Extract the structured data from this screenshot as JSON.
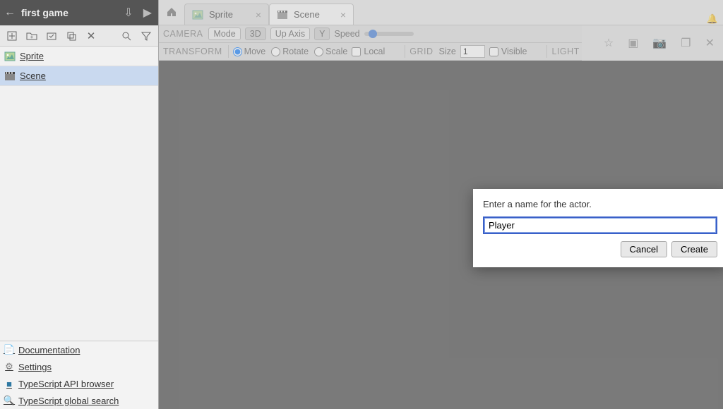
{
  "sidebar": {
    "project_title": "first game",
    "toolbar_icons": [
      "new-asset",
      "new-folder",
      "edit",
      "duplicate",
      "delete",
      "search",
      "filter"
    ],
    "assets": [
      {
        "name": "Sprite",
        "type": "sprite",
        "selected": false
      },
      {
        "name": "Scene",
        "type": "scene",
        "selected": true
      }
    ],
    "links": [
      {
        "label": "Documentation",
        "icon": "doc",
        "color": "#c2b534"
      },
      {
        "label": "Settings",
        "icon": "gear",
        "color": "#7a7a7a"
      },
      {
        "label": "TypeScript API browser",
        "icon": "cube",
        "color": "#2f79a3"
      },
      {
        "label": "TypeScript global search",
        "icon": "search",
        "color": "#c79a1f"
      }
    ]
  },
  "tabs": [
    {
      "label": "Sprite",
      "icon": "sprite",
      "active": false
    },
    {
      "label": "Scene",
      "icon": "scene",
      "active": true
    }
  ],
  "camera_bar": {
    "section": "CAMERA",
    "mode_label": "Mode",
    "mode_value": "3D",
    "up_axis_label": "Up Axis",
    "up_axis_value": "Y",
    "speed_label": "Speed"
  },
  "transform_bar": {
    "section": "TRANSFORM",
    "options": {
      "move": "Move",
      "rotate": "Rotate",
      "scale": "Scale"
    },
    "selected": "move",
    "local_label": "Local",
    "local_checked": false,
    "grid_section": "GRID",
    "size_label": "Size",
    "size_value": "1",
    "visible_label": "Visible",
    "visible_checked": false,
    "light_section": "LIGHT",
    "light_checked": false
  },
  "right_icons": [
    "star",
    "screen",
    "camera",
    "stack",
    "close"
  ],
  "dialog": {
    "title": "Enter a name for the actor.",
    "value": "Player",
    "cancel": "Cancel",
    "create": "Create"
  }
}
